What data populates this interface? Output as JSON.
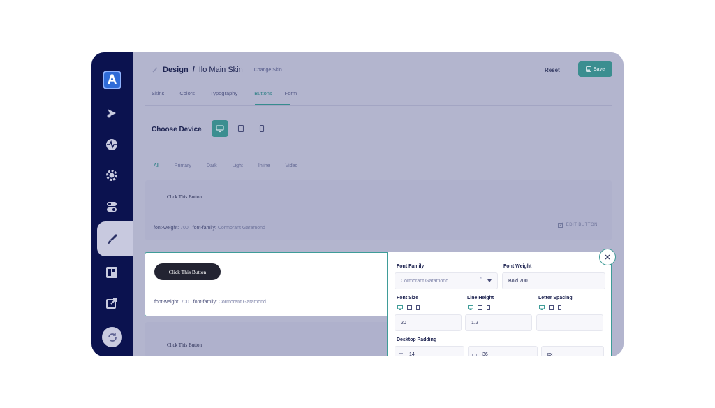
{
  "breadcrumb": {
    "design": "Design",
    "sep": "/",
    "skin": "Ilo Main Skin",
    "change": "Change Skin"
  },
  "header": {
    "reset": "Reset",
    "save": "Save"
  },
  "tabs": [
    {
      "label": "Skins"
    },
    {
      "label": "Colors"
    },
    {
      "label": "Typography"
    },
    {
      "label": "Buttons",
      "active": true
    },
    {
      "label": "Form"
    }
  ],
  "choose_device": {
    "label": "Choose Device",
    "devices": [
      "desktop-icon",
      "tablet-icon",
      "mobile-icon"
    ],
    "selected": "desktop"
  },
  "filters": [
    {
      "label": "All",
      "active": true
    },
    {
      "label": "Primary"
    },
    {
      "label": "Dark"
    },
    {
      "label": "Light"
    },
    {
      "label": "Inline"
    },
    {
      "label": "Video"
    }
  ],
  "cards": [
    {
      "button_text": "Click This Button",
      "weight_label": "font-weight:",
      "weight_value": "700",
      "family_label": "font-family:",
      "family_value": "Cormorant Garamond",
      "edit": "EDIT BUTTON"
    },
    {
      "button_text": "Click This Button",
      "weight_label": "font-weight:",
      "weight_value": "700",
      "family_label": "font-family:",
      "family_value": "Cormorant Garamond"
    },
    {
      "button_text": "Click This Button"
    }
  ],
  "panel": {
    "font_family_label": "Font Family",
    "font_family_value": "Cormorant Garamond",
    "font_family_marker": "*",
    "font_weight_label": "Font Weight",
    "font_weight_value": "Bold 700",
    "font_size_label": "Font Size",
    "font_size_value": "20",
    "line_height_label": "Line Height",
    "line_height_value": "1.2",
    "letter_spacing_label": "Letter Spacing",
    "letter_spacing_value": "",
    "padding_label": "Desktop Padding",
    "padding_v": "14",
    "padding_h": "36",
    "padding_unit": "px"
  },
  "colors": {
    "sidebar": "#0b124f",
    "accent": "#3f9c98",
    "overlay": "#c8c9df"
  }
}
